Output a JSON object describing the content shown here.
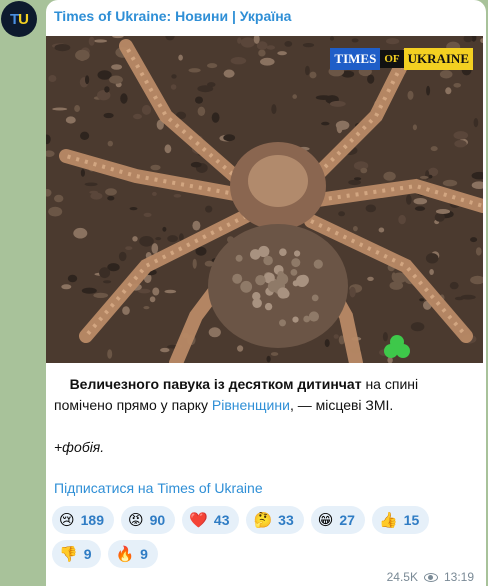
{
  "channel": {
    "avatar_t": "T",
    "avatar_u": "U",
    "name": "Times of Ukraine: Новини | Україна"
  },
  "post": {
    "watermark": {
      "a": "TIMES",
      "b": "OF",
      "c": "UKRAINE"
    },
    "text_bold": "Величезного павука із десятком дитинчат",
    "text_1": " на спині помічено прямо у парку ",
    "text_link": "Рівненщини",
    "text_2": ", — місцеві ЗМІ.",
    "phobia": "+фобія.",
    "subscribe": "Підписатися на Times of Ukraine"
  },
  "reactions": [
    {
      "emoji": "😢",
      "icon": "crying-face-icon",
      "count": "189"
    },
    {
      "emoji": "😡",
      "icon": "angry-face-icon",
      "count": "90"
    },
    {
      "emoji": "❤️",
      "icon": "heart-icon",
      "count": "43"
    },
    {
      "emoji": "🤔",
      "icon": "thinking-face-icon",
      "count": "33"
    },
    {
      "emoji": "😁",
      "icon": "grinning-face-icon",
      "count": "27"
    },
    {
      "emoji": "👍",
      "icon": "thumbs-up-icon",
      "count": "15"
    },
    {
      "emoji": "👎",
      "icon": "thumbs-down-icon",
      "count": "9"
    },
    {
      "emoji": "🔥",
      "icon": "fire-icon",
      "count": "9"
    }
  ],
  "meta": {
    "views": "24.5K",
    "time": "13:19"
  },
  "colors": {
    "link": "#2f8fd6",
    "reaction_bg": "#e6f0f9",
    "chat_bg": "#a8c29a"
  }
}
